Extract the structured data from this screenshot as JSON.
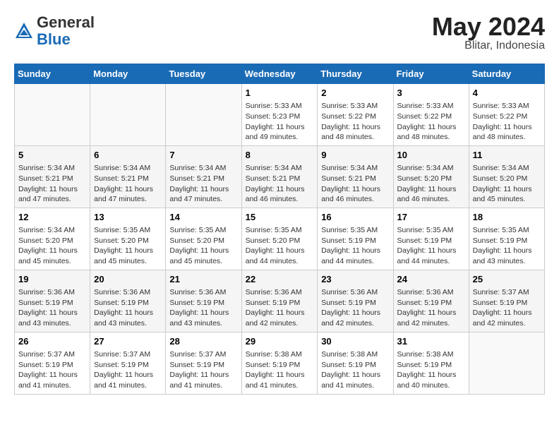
{
  "header": {
    "logo_general": "General",
    "logo_blue": "Blue",
    "month_title": "May 2024",
    "location": "Blitar, Indonesia"
  },
  "days_of_week": [
    "Sunday",
    "Monday",
    "Tuesday",
    "Wednesday",
    "Thursday",
    "Friday",
    "Saturday"
  ],
  "weeks": [
    [
      {
        "day": "",
        "sunrise": "",
        "sunset": "",
        "daylight": ""
      },
      {
        "day": "",
        "sunrise": "",
        "sunset": "",
        "daylight": ""
      },
      {
        "day": "",
        "sunrise": "",
        "sunset": "",
        "daylight": ""
      },
      {
        "day": "1",
        "sunrise": "Sunrise: 5:33 AM",
        "sunset": "Sunset: 5:23 PM",
        "daylight": "Daylight: 11 hours and 49 minutes."
      },
      {
        "day": "2",
        "sunrise": "Sunrise: 5:33 AM",
        "sunset": "Sunset: 5:22 PM",
        "daylight": "Daylight: 11 hours and 48 minutes."
      },
      {
        "day": "3",
        "sunrise": "Sunrise: 5:33 AM",
        "sunset": "Sunset: 5:22 PM",
        "daylight": "Daylight: 11 hours and 48 minutes."
      },
      {
        "day": "4",
        "sunrise": "Sunrise: 5:33 AM",
        "sunset": "Sunset: 5:22 PM",
        "daylight": "Daylight: 11 hours and 48 minutes."
      }
    ],
    [
      {
        "day": "5",
        "sunrise": "Sunrise: 5:34 AM",
        "sunset": "Sunset: 5:21 PM",
        "daylight": "Daylight: 11 hours and 47 minutes."
      },
      {
        "day": "6",
        "sunrise": "Sunrise: 5:34 AM",
        "sunset": "Sunset: 5:21 PM",
        "daylight": "Daylight: 11 hours and 47 minutes."
      },
      {
        "day": "7",
        "sunrise": "Sunrise: 5:34 AM",
        "sunset": "Sunset: 5:21 PM",
        "daylight": "Daylight: 11 hours and 47 minutes."
      },
      {
        "day": "8",
        "sunrise": "Sunrise: 5:34 AM",
        "sunset": "Sunset: 5:21 PM",
        "daylight": "Daylight: 11 hours and 46 minutes."
      },
      {
        "day": "9",
        "sunrise": "Sunrise: 5:34 AM",
        "sunset": "Sunset: 5:21 PM",
        "daylight": "Daylight: 11 hours and 46 minutes."
      },
      {
        "day": "10",
        "sunrise": "Sunrise: 5:34 AM",
        "sunset": "Sunset: 5:20 PM",
        "daylight": "Daylight: 11 hours and 46 minutes."
      },
      {
        "day": "11",
        "sunrise": "Sunrise: 5:34 AM",
        "sunset": "Sunset: 5:20 PM",
        "daylight": "Daylight: 11 hours and 45 minutes."
      }
    ],
    [
      {
        "day": "12",
        "sunrise": "Sunrise: 5:34 AM",
        "sunset": "Sunset: 5:20 PM",
        "daylight": "Daylight: 11 hours and 45 minutes."
      },
      {
        "day": "13",
        "sunrise": "Sunrise: 5:35 AM",
        "sunset": "Sunset: 5:20 PM",
        "daylight": "Daylight: 11 hours and 45 minutes."
      },
      {
        "day": "14",
        "sunrise": "Sunrise: 5:35 AM",
        "sunset": "Sunset: 5:20 PM",
        "daylight": "Daylight: 11 hours and 45 minutes."
      },
      {
        "day": "15",
        "sunrise": "Sunrise: 5:35 AM",
        "sunset": "Sunset: 5:20 PM",
        "daylight": "Daylight: 11 hours and 44 minutes."
      },
      {
        "day": "16",
        "sunrise": "Sunrise: 5:35 AM",
        "sunset": "Sunset: 5:19 PM",
        "daylight": "Daylight: 11 hours and 44 minutes."
      },
      {
        "day": "17",
        "sunrise": "Sunrise: 5:35 AM",
        "sunset": "Sunset: 5:19 PM",
        "daylight": "Daylight: 11 hours and 44 minutes."
      },
      {
        "day": "18",
        "sunrise": "Sunrise: 5:35 AM",
        "sunset": "Sunset: 5:19 PM",
        "daylight": "Daylight: 11 hours and 43 minutes."
      }
    ],
    [
      {
        "day": "19",
        "sunrise": "Sunrise: 5:36 AM",
        "sunset": "Sunset: 5:19 PM",
        "daylight": "Daylight: 11 hours and 43 minutes."
      },
      {
        "day": "20",
        "sunrise": "Sunrise: 5:36 AM",
        "sunset": "Sunset: 5:19 PM",
        "daylight": "Daylight: 11 hours and 43 minutes."
      },
      {
        "day": "21",
        "sunrise": "Sunrise: 5:36 AM",
        "sunset": "Sunset: 5:19 PM",
        "daylight": "Daylight: 11 hours and 43 minutes."
      },
      {
        "day": "22",
        "sunrise": "Sunrise: 5:36 AM",
        "sunset": "Sunset: 5:19 PM",
        "daylight": "Daylight: 11 hours and 42 minutes."
      },
      {
        "day": "23",
        "sunrise": "Sunrise: 5:36 AM",
        "sunset": "Sunset: 5:19 PM",
        "daylight": "Daylight: 11 hours and 42 minutes."
      },
      {
        "day": "24",
        "sunrise": "Sunrise: 5:36 AM",
        "sunset": "Sunset: 5:19 PM",
        "daylight": "Daylight: 11 hours and 42 minutes."
      },
      {
        "day": "25",
        "sunrise": "Sunrise: 5:37 AM",
        "sunset": "Sunset: 5:19 PM",
        "daylight": "Daylight: 11 hours and 42 minutes."
      }
    ],
    [
      {
        "day": "26",
        "sunrise": "Sunrise: 5:37 AM",
        "sunset": "Sunset: 5:19 PM",
        "daylight": "Daylight: 11 hours and 41 minutes."
      },
      {
        "day": "27",
        "sunrise": "Sunrise: 5:37 AM",
        "sunset": "Sunset: 5:19 PM",
        "daylight": "Daylight: 11 hours and 41 minutes."
      },
      {
        "day": "28",
        "sunrise": "Sunrise: 5:37 AM",
        "sunset": "Sunset: 5:19 PM",
        "daylight": "Daylight: 11 hours and 41 minutes."
      },
      {
        "day": "29",
        "sunrise": "Sunrise: 5:38 AM",
        "sunset": "Sunset: 5:19 PM",
        "daylight": "Daylight: 11 hours and 41 minutes."
      },
      {
        "day": "30",
        "sunrise": "Sunrise: 5:38 AM",
        "sunset": "Sunset: 5:19 PM",
        "daylight": "Daylight: 11 hours and 41 minutes."
      },
      {
        "day": "31",
        "sunrise": "Sunrise: 5:38 AM",
        "sunset": "Sunset: 5:19 PM",
        "daylight": "Daylight: 11 hours and 40 minutes."
      },
      {
        "day": "",
        "sunrise": "",
        "sunset": "",
        "daylight": ""
      }
    ]
  ]
}
